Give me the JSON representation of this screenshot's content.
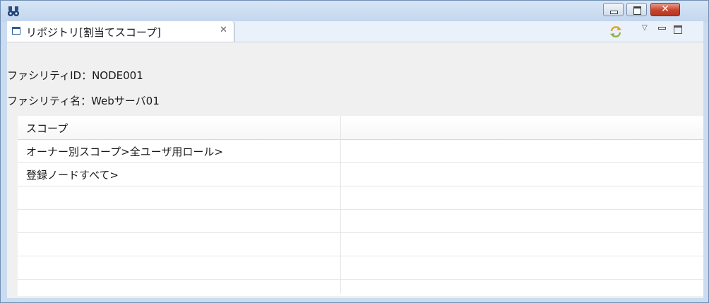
{
  "window": {
    "title": "",
    "close_glyph": "✕",
    "icons": [
      "app-binoculars-icon",
      "minimize-icon",
      "maximize-icon",
      "close-icon"
    ]
  },
  "view": {
    "tab_label": "リポジトリ[割当てスコープ]",
    "tab_close_glyph": "✕",
    "toolbar_icons": [
      "refresh-icon",
      "view-menu-icon",
      "view-minimize-icon",
      "view-maximize-icon"
    ],
    "view_menu_glyph": "▽"
  },
  "facility": {
    "id_line": "ファシリティID：NODE001",
    "name_line": "ファシリティ名：Webサーバ01"
  },
  "table": {
    "columns": [
      "スコープ",
      ""
    ],
    "rows": [
      "オーナー別スコープ>全ユーザ用ロール>",
      "登録ノードすべて>",
      "",
      "",
      "",
      "",
      ""
    ]
  },
  "colors": {
    "title_bar": "#cbdcf0",
    "close_button": "#c8432b",
    "panel_background": "#f0f0f0"
  }
}
